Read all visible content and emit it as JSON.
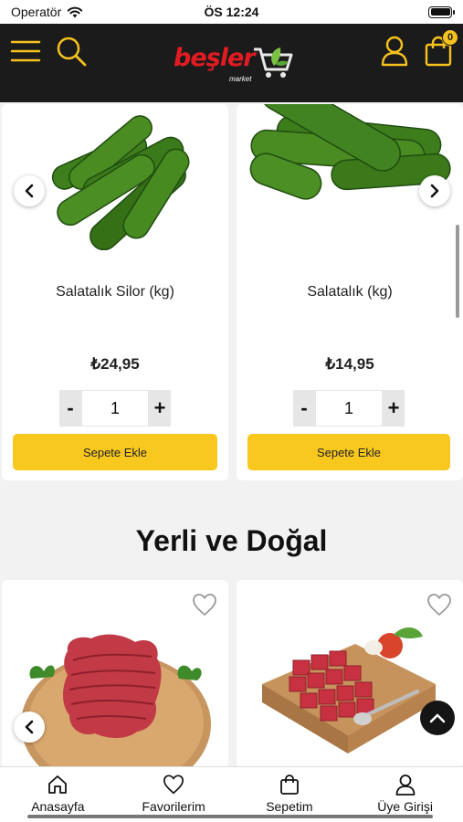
{
  "status_bar": {
    "carrier": "Operatör",
    "time": "ÖS 12:24"
  },
  "header": {
    "logo_text": "beşler",
    "logo_subtext": "market",
    "cart_count": "0"
  },
  "products_top": [
    {
      "name": "Salatalık Silor (kg)",
      "price": "₺24,95",
      "quantity": "1",
      "minus_label": "-",
      "plus_label": "+",
      "add_label": "Sepete Ekle"
    },
    {
      "name": "Salatalık (kg)",
      "price": "₺14,95",
      "quantity": "1",
      "minus_label": "-",
      "plus_label": "+",
      "add_label": "Sepete Ekle"
    }
  ],
  "section": {
    "title": "Yerli ve Doğal"
  },
  "bottom_nav": [
    {
      "label": "Anasayfa",
      "icon": "home-icon"
    },
    {
      "label": "Favorilerim",
      "icon": "heart-icon"
    },
    {
      "label": "Sepetim",
      "icon": "bag-icon"
    },
    {
      "label": "Üye Girişi",
      "icon": "user-icon"
    }
  ],
  "colors": {
    "header_bg": "#1b1b1b",
    "accent_yellow": "#f8c81f",
    "brand_red": "#e11b22",
    "brand_green": "#7cc242"
  }
}
